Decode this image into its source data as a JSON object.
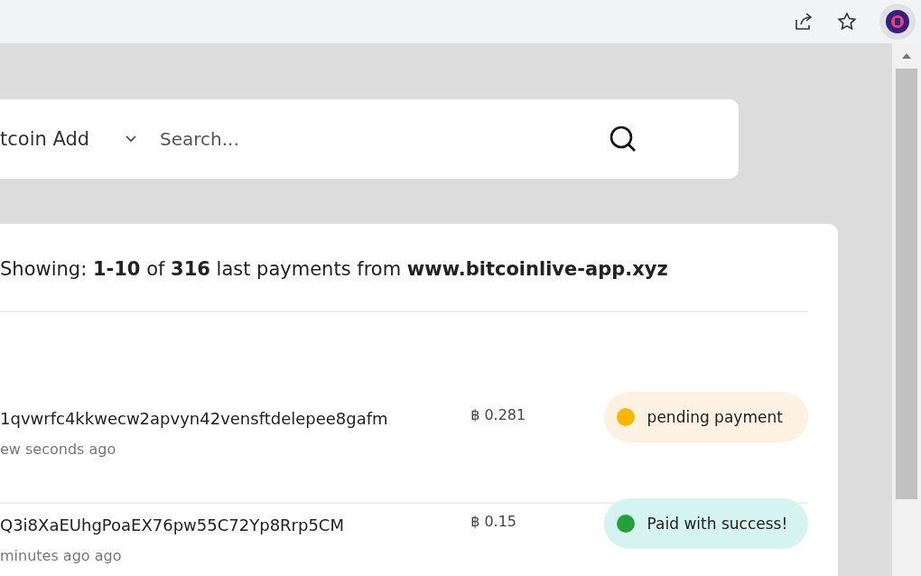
{
  "search": {
    "filter": "tcoin Add",
    "placeholder": "Search..."
  },
  "summary": "Showing: **1-10** of **316** last payments from **www.bitcoinlive-app.xyz**",
  "payments": [
    {
      "address": "1qvwrfc4kkwecw2apvyn42vensftdelepee8gafm",
      "time": "ew seconds ago",
      "amount": "฿ 0.281",
      "status": "pending payment",
      "kind": "pending",
      "color": "#f9b800"
    },
    {
      "address": "Q3i8XaEUhgPoaEX76pw55C72Yp8Rrp5CM",
      "time": "minutes ago ago",
      "amount": "฿ 0.15",
      "status": "Paid with success!",
      "kind": "paid",
      "color": "#23a03c"
    }
  ]
}
